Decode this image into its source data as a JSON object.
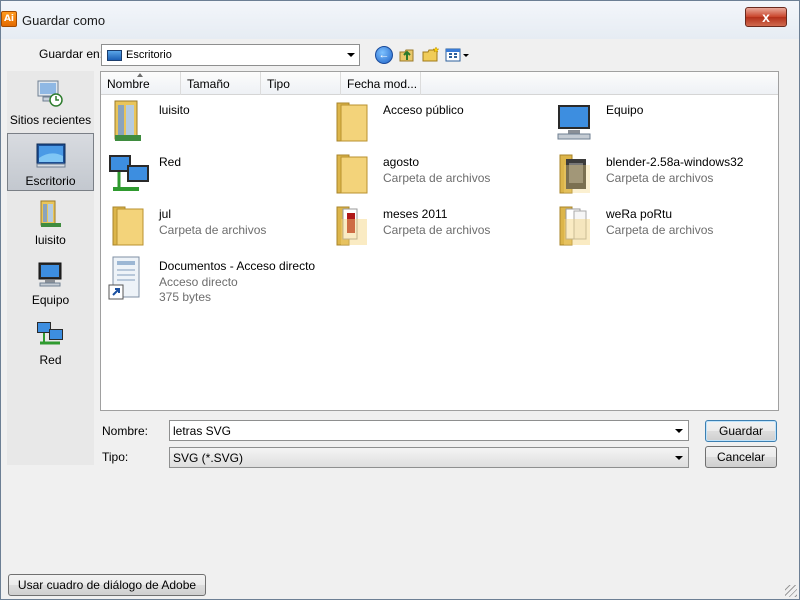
{
  "window": {
    "title": "Guardar como",
    "app_icon_text": "Ai",
    "close_symbol": "x",
    "app_icon": "illustrator-app-icon"
  },
  "toolbar": {
    "save_in_label": "Guardar en:",
    "save_in_value": "Escritorio",
    "back_symbol": "←",
    "icons": [
      "back-icon",
      "up-folder-icon",
      "new-folder-icon",
      "views-menu-icon"
    ]
  },
  "places": [
    {
      "label": "Sitios recientes",
      "icon": "recent-places-icon",
      "selected": false
    },
    {
      "label": "Escritorio",
      "icon": "desktop-icon",
      "selected": true
    },
    {
      "label": "luisito",
      "icon": "user-folder-icon",
      "selected": false
    },
    {
      "label": "Equipo",
      "icon": "computer-icon",
      "selected": false
    },
    {
      "label": "Red",
      "icon": "network-icon",
      "selected": false
    }
  ],
  "columns": [
    "Nombre",
    "Tamaño",
    "Tipo",
    "Fecha mod..."
  ],
  "files": [
    {
      "name": "luisito",
      "sub1": "",
      "sub2": "",
      "icon": "user-folder-icon"
    },
    {
      "name": "Acceso público",
      "sub1": "",
      "sub2": "",
      "icon": "folder-icon"
    },
    {
      "name": "Equipo",
      "sub1": "",
      "sub2": "",
      "icon": "computer-icon"
    },
    {
      "name": "Red",
      "sub1": "",
      "sub2": "",
      "icon": "network-icon"
    },
    {
      "name": "agosto",
      "sub1": "Carpeta de archivos",
      "sub2": "",
      "icon": "folder-icon"
    },
    {
      "name": "blender-2.58a-windows32",
      "sub1": "Carpeta de archivos",
      "sub2": "",
      "icon": "folder-dark-icon"
    },
    {
      "name": "jul",
      "sub1": "Carpeta de archivos",
      "sub2": "",
      "icon": "folder-icon"
    },
    {
      "name": "meses 2011",
      "sub1": "Carpeta de archivos",
      "sub2": "",
      "icon": "folder-documents-icon"
    },
    {
      "name": "weRa poRtu",
      "sub1": "Carpeta de archivos",
      "sub2": "",
      "icon": "folder-documents-icon"
    },
    {
      "name": "Documentos - Acceso directo",
      "sub1": "Acceso directo",
      "sub2": "375 bytes",
      "icon": "shortcut-icon"
    }
  ],
  "form": {
    "name_label": "Nombre:",
    "name_value": "letras SVG",
    "type_label": "Tipo:",
    "type_value": "SVG (*.SVG)"
  },
  "buttons": {
    "save": "Guardar",
    "cancel": "Cancelar",
    "adobe_dialog": "Usar cuadro de diálogo de Adobe"
  },
  "colors": {
    "selection": "#c3c8cf",
    "folder": "#f3d37a",
    "accent": "#3c7fb1"
  }
}
